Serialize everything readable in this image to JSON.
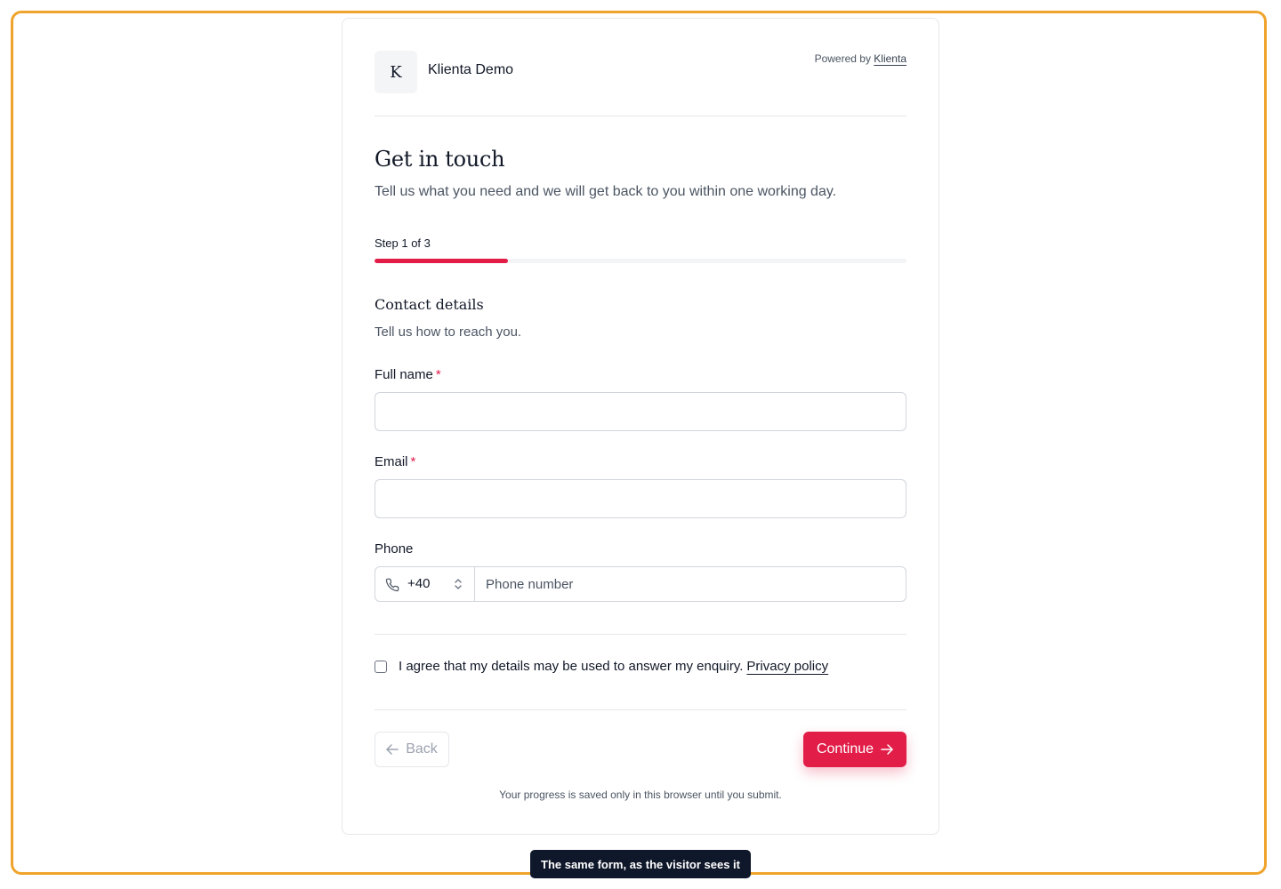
{
  "brand": {
    "logo_letter": "K",
    "name": "Klienta Demo",
    "powered_by_prefix": "Powered by",
    "powered_by_link": "Klienta"
  },
  "form": {
    "title": "Get in touch",
    "subtitle": "Tell us what you need and we will get back to you within one working day.",
    "step_label": "Step 1 of 3",
    "progress_fraction": 0.25,
    "section_title": "Contact details",
    "section_subtitle": "Tell us how to reach you.",
    "fields": {
      "full_name": {
        "label": "Full name",
        "required_mark": "*",
        "value": ""
      },
      "email": {
        "label": "Email",
        "required_mark": "*",
        "value": ""
      },
      "phone": {
        "label": "Phone",
        "country_code": "+40",
        "placeholder": "Phone number",
        "value": ""
      }
    },
    "consent": {
      "text": "I agree that my details may be used to answer my enquiry.",
      "link": "Privacy policy",
      "checked": false
    },
    "back_label": "Back",
    "continue_label": "Continue",
    "note": "Your progress is saved only in this browser until you submit."
  },
  "caption": "The same form, as the visitor sees it",
  "colors": {
    "accent": "#e11d48",
    "frame_border": "#f0a32a",
    "caption_bg": "#0f172a"
  },
  "icons": {
    "phone": "phone-icon",
    "select_arrows": "chevron-up-down-icon",
    "back": "arrow-left-icon",
    "continue": "arrow-right-icon"
  }
}
